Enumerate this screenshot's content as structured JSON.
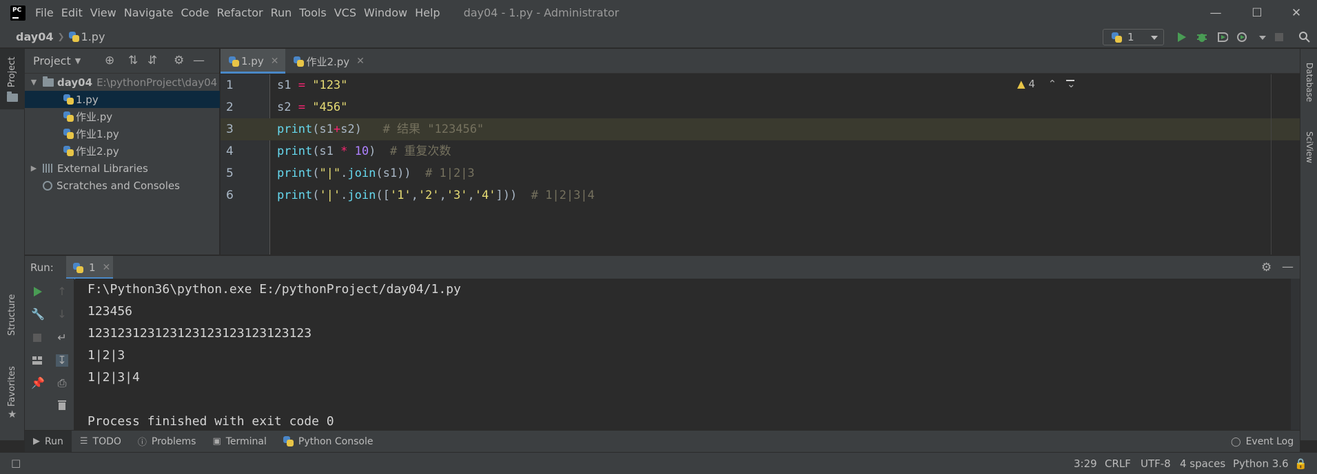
{
  "menu": [
    "File",
    "Edit",
    "View",
    "Navigate",
    "Code",
    "Refactor",
    "Run",
    "Tools",
    "VCS",
    "Window",
    "Help"
  ],
  "window_title": "day04 - 1.py - Administrator",
  "breadcrumb": {
    "root": "day04",
    "file": "1.py"
  },
  "run_config": {
    "label": "1"
  },
  "left_stripe": {
    "project": "Project",
    "structure": "Structure",
    "favorites": "Favorites"
  },
  "right_stripe": {
    "database": "Database",
    "sciview": "SciView"
  },
  "project_panel": {
    "title": "Project",
    "root": {
      "name": "day04",
      "path": "E:\\pythonProject\\day04"
    },
    "files": [
      "1.py",
      "作业.py",
      "作业1.py",
      "作业2.py"
    ],
    "external": "External Libraries",
    "scratches": "Scratches and Consoles"
  },
  "editor": {
    "tabs": [
      "1.py",
      "作业2.py"
    ],
    "line_numbers": [
      "1",
      "2",
      "3",
      "4",
      "5",
      "6"
    ],
    "inspection_count": "4"
  },
  "run_window": {
    "label": "Run:",
    "tab": "1",
    "output": [
      "F:\\Python36\\python.exe E:/pythonProject/day04/1.py",
      "123456",
      "123123123123123123123123123123",
      "1|2|3",
      "1|2|3|4",
      "",
      "Process finished with exit code 0"
    ]
  },
  "bottom_tools": {
    "run": "Run",
    "todo": "TODO",
    "problems": "Problems",
    "terminal": "Terminal",
    "python_console": "Python Console",
    "event_log": "Event Log"
  },
  "status": {
    "position": "3:29",
    "line_sep": "CRLF",
    "encoding": "UTF-8",
    "indent": "4 spaces",
    "interpreter": "Python 3.6"
  }
}
